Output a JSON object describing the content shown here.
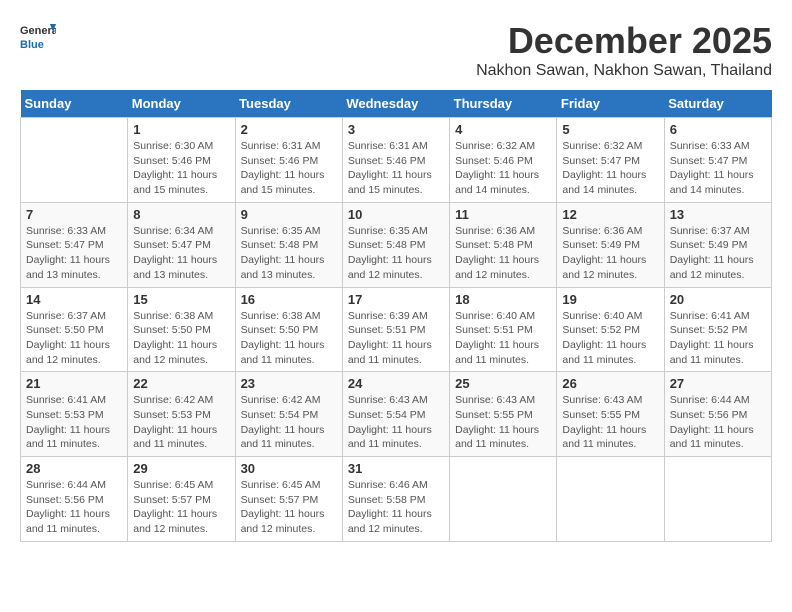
{
  "header": {
    "logo_line1": "General",
    "logo_line2": "Blue",
    "month": "December 2025",
    "location": "Nakhon Sawan, Nakhon Sawan, Thailand"
  },
  "weekdays": [
    "Sunday",
    "Monday",
    "Tuesday",
    "Wednesday",
    "Thursday",
    "Friday",
    "Saturday"
  ],
  "weeks": [
    [
      {
        "day": "",
        "sunrise": "",
        "sunset": "",
        "daylight": ""
      },
      {
        "day": "1",
        "sunrise": "Sunrise: 6:30 AM",
        "sunset": "Sunset: 5:46 PM",
        "daylight": "Daylight: 11 hours and 15 minutes."
      },
      {
        "day": "2",
        "sunrise": "Sunrise: 6:31 AM",
        "sunset": "Sunset: 5:46 PM",
        "daylight": "Daylight: 11 hours and 15 minutes."
      },
      {
        "day": "3",
        "sunrise": "Sunrise: 6:31 AM",
        "sunset": "Sunset: 5:46 PM",
        "daylight": "Daylight: 11 hours and 15 minutes."
      },
      {
        "day": "4",
        "sunrise": "Sunrise: 6:32 AM",
        "sunset": "Sunset: 5:46 PM",
        "daylight": "Daylight: 11 hours and 14 minutes."
      },
      {
        "day": "5",
        "sunrise": "Sunrise: 6:32 AM",
        "sunset": "Sunset: 5:47 PM",
        "daylight": "Daylight: 11 hours and 14 minutes."
      },
      {
        "day": "6",
        "sunrise": "Sunrise: 6:33 AM",
        "sunset": "Sunset: 5:47 PM",
        "daylight": "Daylight: 11 hours and 14 minutes."
      }
    ],
    [
      {
        "day": "7",
        "sunrise": "Sunrise: 6:33 AM",
        "sunset": "Sunset: 5:47 PM",
        "daylight": "Daylight: 11 hours and 13 minutes."
      },
      {
        "day": "8",
        "sunrise": "Sunrise: 6:34 AM",
        "sunset": "Sunset: 5:47 PM",
        "daylight": "Daylight: 11 hours and 13 minutes."
      },
      {
        "day": "9",
        "sunrise": "Sunrise: 6:35 AM",
        "sunset": "Sunset: 5:48 PM",
        "daylight": "Daylight: 11 hours and 13 minutes."
      },
      {
        "day": "10",
        "sunrise": "Sunrise: 6:35 AM",
        "sunset": "Sunset: 5:48 PM",
        "daylight": "Daylight: 11 hours and 12 minutes."
      },
      {
        "day": "11",
        "sunrise": "Sunrise: 6:36 AM",
        "sunset": "Sunset: 5:48 PM",
        "daylight": "Daylight: 11 hours and 12 minutes."
      },
      {
        "day": "12",
        "sunrise": "Sunrise: 6:36 AM",
        "sunset": "Sunset: 5:49 PM",
        "daylight": "Daylight: 11 hours and 12 minutes."
      },
      {
        "day": "13",
        "sunrise": "Sunrise: 6:37 AM",
        "sunset": "Sunset: 5:49 PM",
        "daylight": "Daylight: 11 hours and 12 minutes."
      }
    ],
    [
      {
        "day": "14",
        "sunrise": "Sunrise: 6:37 AM",
        "sunset": "Sunset: 5:50 PM",
        "daylight": "Daylight: 11 hours and 12 minutes."
      },
      {
        "day": "15",
        "sunrise": "Sunrise: 6:38 AM",
        "sunset": "Sunset: 5:50 PM",
        "daylight": "Daylight: 11 hours and 12 minutes."
      },
      {
        "day": "16",
        "sunrise": "Sunrise: 6:38 AM",
        "sunset": "Sunset: 5:50 PM",
        "daylight": "Daylight: 11 hours and 11 minutes."
      },
      {
        "day": "17",
        "sunrise": "Sunrise: 6:39 AM",
        "sunset": "Sunset: 5:51 PM",
        "daylight": "Daylight: 11 hours and 11 minutes."
      },
      {
        "day": "18",
        "sunrise": "Sunrise: 6:40 AM",
        "sunset": "Sunset: 5:51 PM",
        "daylight": "Daylight: 11 hours and 11 minutes."
      },
      {
        "day": "19",
        "sunrise": "Sunrise: 6:40 AM",
        "sunset": "Sunset: 5:52 PM",
        "daylight": "Daylight: 11 hours and 11 minutes."
      },
      {
        "day": "20",
        "sunrise": "Sunrise: 6:41 AM",
        "sunset": "Sunset: 5:52 PM",
        "daylight": "Daylight: 11 hours and 11 minutes."
      }
    ],
    [
      {
        "day": "21",
        "sunrise": "Sunrise: 6:41 AM",
        "sunset": "Sunset: 5:53 PM",
        "daylight": "Daylight: 11 hours and 11 minutes."
      },
      {
        "day": "22",
        "sunrise": "Sunrise: 6:42 AM",
        "sunset": "Sunset: 5:53 PM",
        "daylight": "Daylight: 11 hours and 11 minutes."
      },
      {
        "day": "23",
        "sunrise": "Sunrise: 6:42 AM",
        "sunset": "Sunset: 5:54 PM",
        "daylight": "Daylight: 11 hours and 11 minutes."
      },
      {
        "day": "24",
        "sunrise": "Sunrise: 6:43 AM",
        "sunset": "Sunset: 5:54 PM",
        "daylight": "Daylight: 11 hours and 11 minutes."
      },
      {
        "day": "25",
        "sunrise": "Sunrise: 6:43 AM",
        "sunset": "Sunset: 5:55 PM",
        "daylight": "Daylight: 11 hours and 11 minutes."
      },
      {
        "day": "26",
        "sunrise": "Sunrise: 6:43 AM",
        "sunset": "Sunset: 5:55 PM",
        "daylight": "Daylight: 11 hours and 11 minutes."
      },
      {
        "day": "27",
        "sunrise": "Sunrise: 6:44 AM",
        "sunset": "Sunset: 5:56 PM",
        "daylight": "Daylight: 11 hours and 11 minutes."
      }
    ],
    [
      {
        "day": "28",
        "sunrise": "Sunrise: 6:44 AM",
        "sunset": "Sunset: 5:56 PM",
        "daylight": "Daylight: 11 hours and 11 minutes."
      },
      {
        "day": "29",
        "sunrise": "Sunrise: 6:45 AM",
        "sunset": "Sunset: 5:57 PM",
        "daylight": "Daylight: 11 hours and 12 minutes."
      },
      {
        "day": "30",
        "sunrise": "Sunrise: 6:45 AM",
        "sunset": "Sunset: 5:57 PM",
        "daylight": "Daylight: 11 hours and 12 minutes."
      },
      {
        "day": "31",
        "sunrise": "Sunrise: 6:46 AM",
        "sunset": "Sunset: 5:58 PM",
        "daylight": "Daylight: 11 hours and 12 minutes."
      },
      {
        "day": "",
        "sunrise": "",
        "sunset": "",
        "daylight": ""
      },
      {
        "day": "",
        "sunrise": "",
        "sunset": "",
        "daylight": ""
      },
      {
        "day": "",
        "sunrise": "",
        "sunset": "",
        "daylight": ""
      }
    ]
  ]
}
